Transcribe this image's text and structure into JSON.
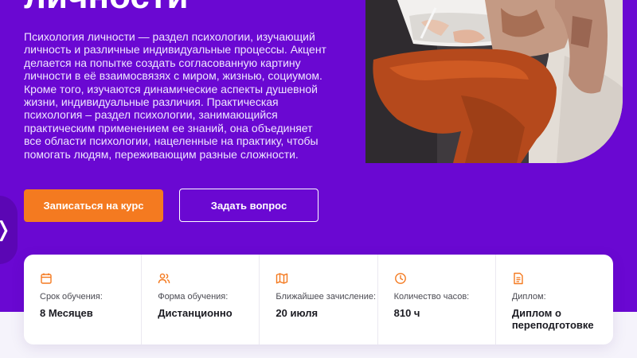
{
  "hero": {
    "title": "личности",
    "description": "Психология личности — раздел психологии, изучающий личность и различные индивидуальные процессы. Акцент делается на попытке создать согласованную картину личности в её взаимосвязях с миром, жизнью, социумом. Кроме того, изучаются динамические аспекты душевной жизни, индивидуальные различия. Практическая психология – раздел психологии, занимающийся практическим применением ее знаний, она объединяет все области психологии, нацеленные на практику, чтобы помогать людям, переживающим разные сложности.",
    "primary_button": "Записаться на курс",
    "secondary_button": "Задать вопрос",
    "side_tab_glyph": "❭"
  },
  "info": {
    "items": [
      {
        "icon": "calendar-icon",
        "label": "Срок обучения:",
        "value": "8 Месяцев"
      },
      {
        "icon": "users-icon",
        "label": "Форма обучения:",
        "value": "Дистанционно"
      },
      {
        "icon": "map-icon",
        "label": "Ближайшее зачисление:",
        "value": "20 июля"
      },
      {
        "icon": "clock-icon",
        "label": "Количество часов:",
        "value": "810 ч"
      },
      {
        "icon": "document-icon",
        "label": "Диплом:",
        "value": "Диплом о переподготовке"
      }
    ]
  },
  "colors": {
    "hero_bg": "#6a08d2",
    "accent_orange": "#f47a20",
    "card_bg": "#ffffff",
    "page_bg": "#f5f3fb"
  }
}
